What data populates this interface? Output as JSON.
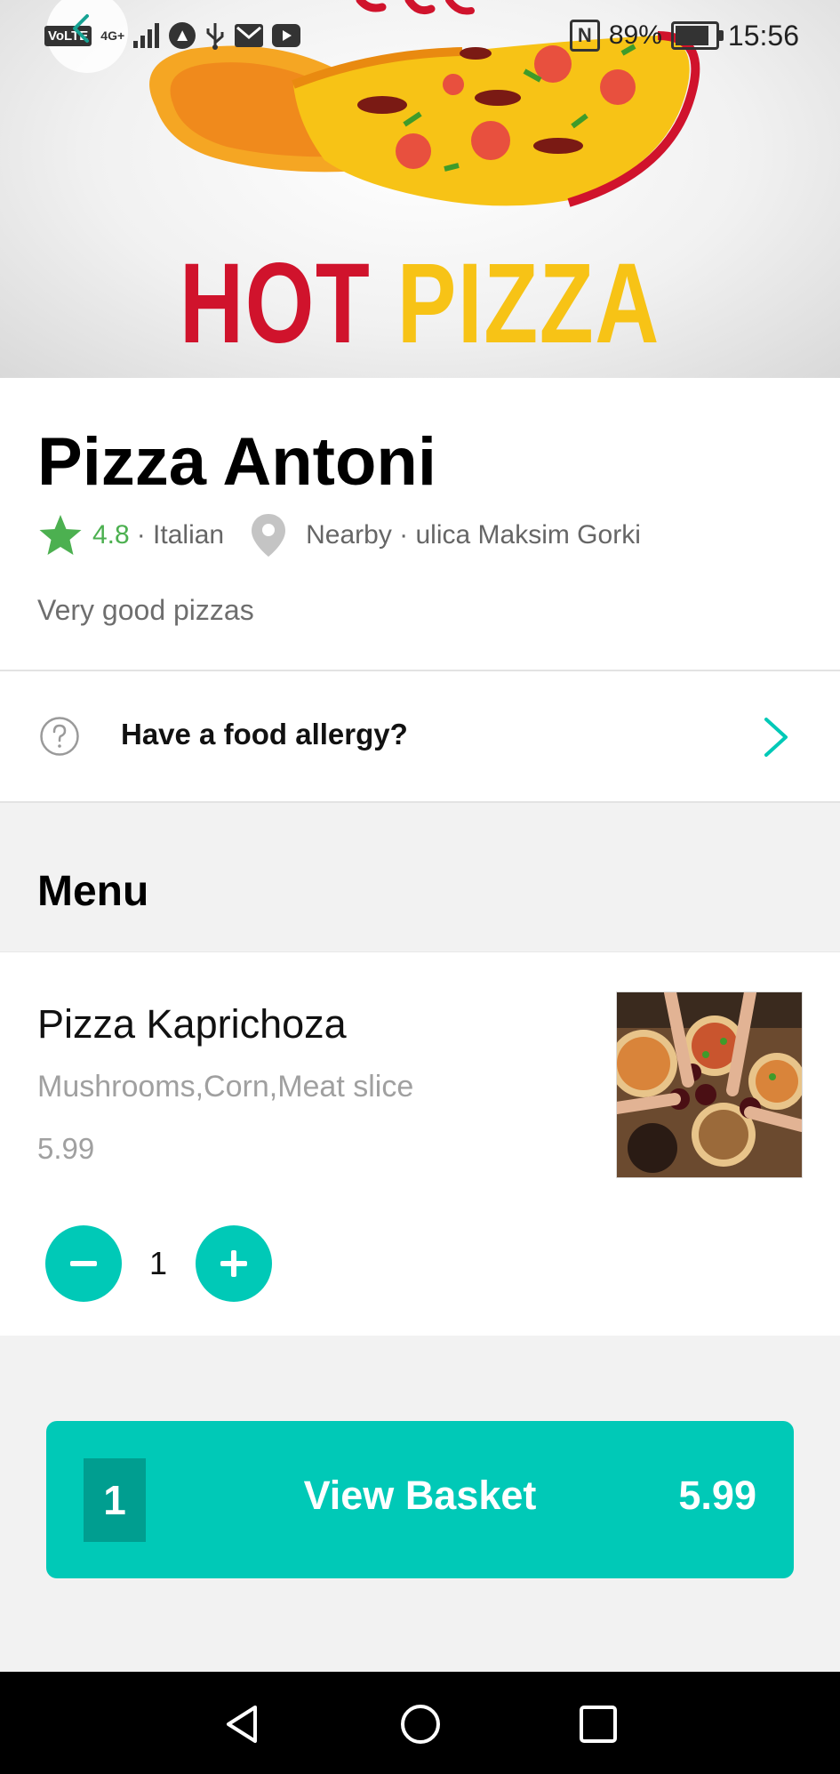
{
  "status_bar": {
    "volte": "VoLTE",
    "network": "4G+",
    "battery_percent": "89%",
    "battery_level": 0.89,
    "time": "15:56",
    "icons": [
      "signal-icon",
      "drive-icon",
      "usb-icon",
      "mail-icon",
      "youtube-icon",
      "nfc-icon",
      "battery-icon"
    ]
  },
  "hero": {
    "title_word_1": "HOT",
    "title_word_2": "PIZZA",
    "back_icon": "back-arrow-icon"
  },
  "restaurant": {
    "name": "Pizza Antoni",
    "rating": "4.8",
    "cuisine": "· Italian",
    "location": "Nearby · ulica Maksim Gorki",
    "description": "Very good pizzas"
  },
  "allergy": {
    "label": "Have a food allergy?"
  },
  "menu": {
    "heading": "Menu",
    "items": [
      {
        "name": "Pizza Kaprichoza",
        "description": "Mushrooms,Corn,Meat slice",
        "price": "5.99",
        "quantity": "1"
      }
    ]
  },
  "basket": {
    "count": "1",
    "label": "View Basket",
    "total": "5.99"
  },
  "colors": {
    "accent": "#00c9b7",
    "rating_green": "#4cb050",
    "hero_red": "#d0132c",
    "hero_yellow": "#f7c316"
  }
}
